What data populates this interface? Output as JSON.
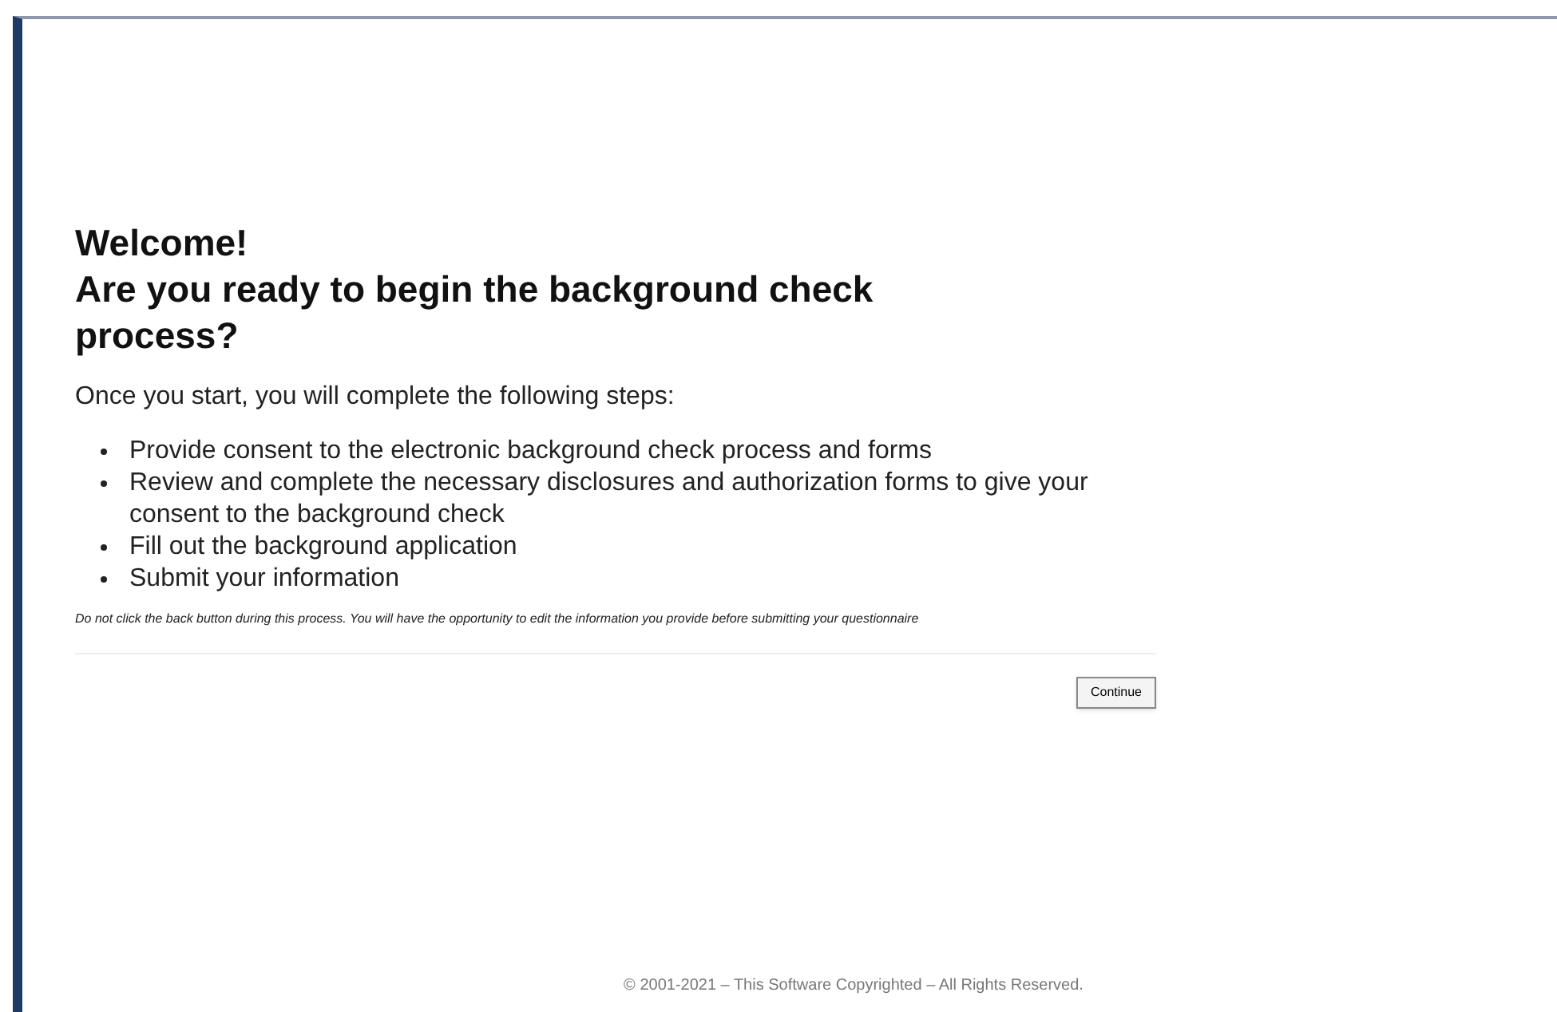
{
  "heading": {
    "line_1": "Welcome!",
    "line_2": "Are you ready to begin the background check process?"
  },
  "intro": "Once you start, you will complete the following steps:",
  "steps": [
    "Provide consent to the electronic background check process and forms",
    "Review and complete the necessary disclosures and authorization forms to give your consent to the background check",
    "Fill out the background application",
    "Submit your information"
  ],
  "note": "Do not click the back button during this process. You will have the opportunity to edit the information you provide before submitting your questionnaire",
  "continue_button": "Continue",
  "footer": "© 2001-2021 – This Software Copyrighted – All Rights Reserved."
}
